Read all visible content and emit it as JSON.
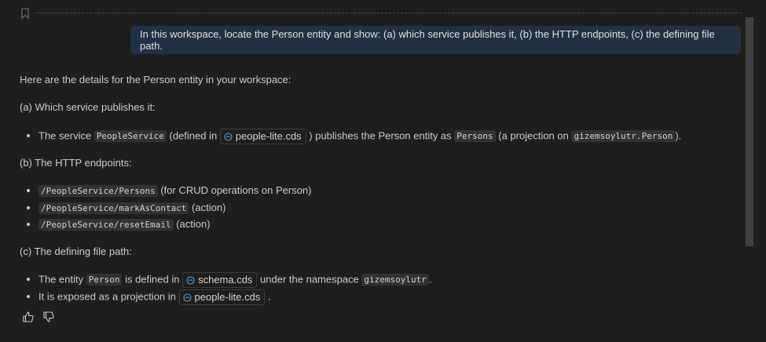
{
  "user_message": "In this workspace, locate the Person entity and show: (a) which service publishes it, (b) the HTTP endpoints, (c) the defining file path.",
  "response": {
    "intro": "Here are the details for the Person entity in your workspace:",
    "section_a": {
      "heading": "(a) Which service publishes it:",
      "b1": {
        "t1": "The service ",
        "c1": "PeopleService",
        "t2": " (defined in ",
        "file": "people-lite.cds",
        "t3": " ) publishes the Person entity as ",
        "c2": "Persons",
        "t4": " (a projection on ",
        "c3": "gizemsoylutr.Person",
        "t5": ")."
      }
    },
    "section_b": {
      "heading": "(b) The HTTP endpoints:",
      "e1": {
        "code": "/PeopleService/Persons",
        "note": " (for CRUD operations on Person)"
      },
      "e2": {
        "code": "/PeopleService/markAsContact",
        "note": " (action)"
      },
      "e3": {
        "code": "/PeopleService/resetEmail",
        "note": " (action)"
      }
    },
    "section_c": {
      "heading": "(c) The defining file path:",
      "b1": {
        "t1": "The entity ",
        "c1": "Person",
        "t2": " is defined in ",
        "file": "schema.cds",
        "t3": "  under the namespace ",
        "c2": "gizemsoylutr",
        "t4": "."
      },
      "b2": {
        "t1": "It is exposed as a projection in ",
        "file": "people-lite.cds",
        "t2": " ."
      }
    }
  },
  "icons": {
    "bookmark": "bookmark-icon",
    "file": "cds-file-icon",
    "thumbs_up": "thumbs-up-icon",
    "thumbs_down": "thumbs-down-icon"
  },
  "colors": {
    "background": "#1e1e1e",
    "user_bubble": "#233041",
    "inline_code_bg": "#323232",
    "file_icon": "#4f9fd9"
  }
}
